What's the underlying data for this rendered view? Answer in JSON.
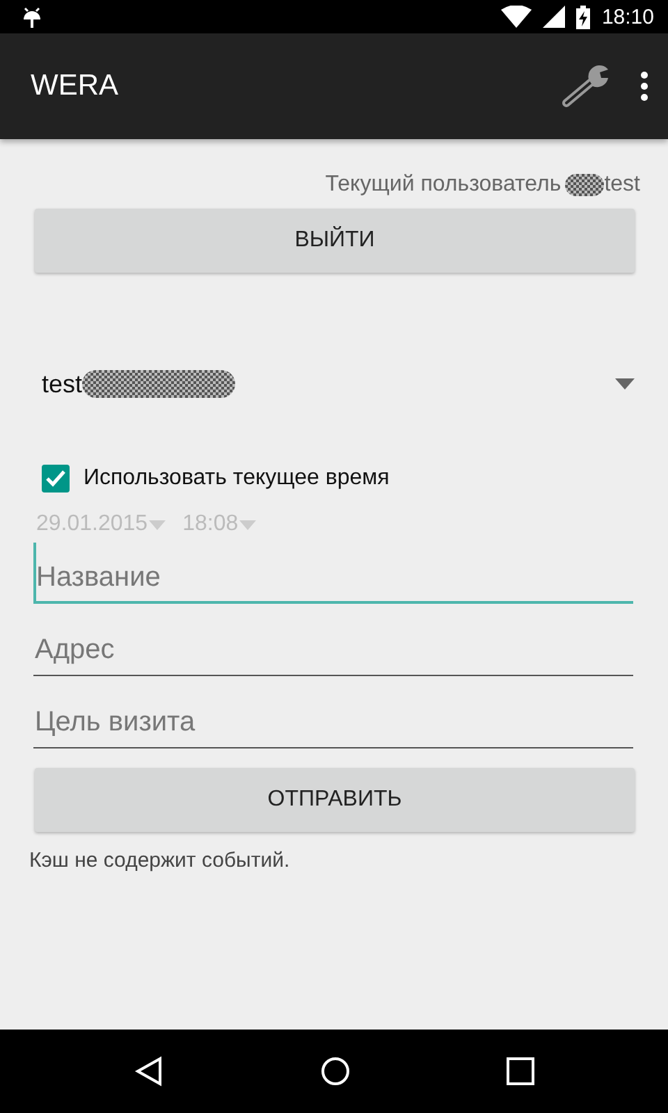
{
  "status_bar": {
    "time": "18:10"
  },
  "app_bar": {
    "title": "WERA"
  },
  "current_user": {
    "label": "Текущий пользователь",
    "name": "test"
  },
  "logout_button": "ВЫЙТИ",
  "user_spinner": {
    "value": "test"
  },
  "use_current_time": {
    "label": "Использовать текущее время",
    "checked": true
  },
  "date_picker": {
    "value": "29.01.2015",
    "disabled": true
  },
  "time_picker": {
    "value": "18:08",
    "disabled": true
  },
  "fields": [
    {
      "placeholder": "Название",
      "focused": true
    },
    {
      "placeholder": "Адрес",
      "focused": false
    },
    {
      "placeholder": "Цель визита",
      "focused": false
    }
  ],
  "send_button": "ОТПРАВИТЬ",
  "cache_message": "Кэш не содержит событий."
}
